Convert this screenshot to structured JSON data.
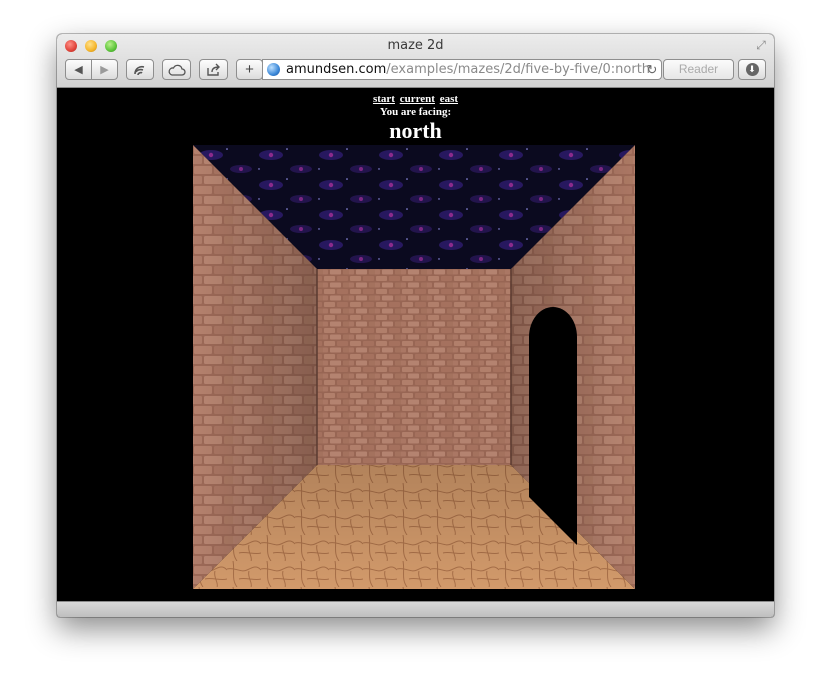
{
  "window": {
    "title": "maze 2d"
  },
  "toolbar": {
    "back_icon": "◀",
    "forward_icon": "▶",
    "add_icon": "+",
    "reload_icon": "↻",
    "reader_label": "Reader",
    "fullscreen_icon": "⤢",
    "download_icon": "⬇"
  },
  "address_bar": {
    "host": "amundsen.com",
    "path": "/examples/mazes/2d/five-by-five/0:north"
  },
  "page": {
    "nav_links": [
      "start",
      "current",
      "east"
    ],
    "facing_label": "You are facing:",
    "direction": "north"
  },
  "colors": {
    "background": "#000000",
    "brick": "#b27a68",
    "floor": "#d49c6e",
    "sky": "#0c0b22"
  }
}
